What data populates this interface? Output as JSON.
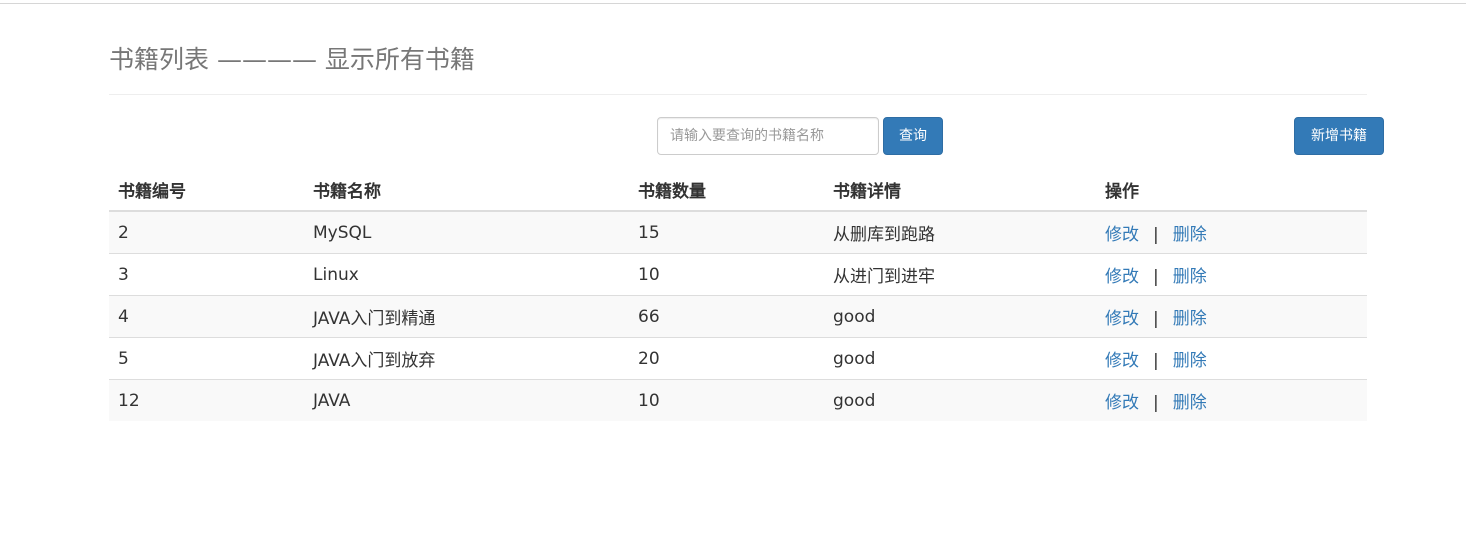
{
  "header": {
    "title": "书籍列表 ———— 显示所有书籍"
  },
  "search": {
    "placeholder": "请输入要查询的书籍名称",
    "value": "",
    "button_label": "查询"
  },
  "toolbar": {
    "add_label": "新增书籍"
  },
  "table": {
    "columns": [
      "书籍编号",
      "书籍名称",
      "书籍数量",
      "书籍详情",
      "操作"
    ],
    "rows": [
      {
        "id": "2",
        "name": "MySQL",
        "count": "15",
        "detail": "从删库到跑路"
      },
      {
        "id": "3",
        "name": "Linux",
        "count": "10",
        "detail": "从进门到进牢"
      },
      {
        "id": "4",
        "name": "JAVA入门到精通",
        "count": "66",
        "detail": "good"
      },
      {
        "id": "5",
        "name": "JAVA入门到放弃",
        "count": "20",
        "detail": "good"
      },
      {
        "id": "12",
        "name": "JAVA",
        "count": "10",
        "detail": "good"
      }
    ],
    "edit_label": "修改",
    "separator": "|",
    "delete_label": "删除"
  },
  "colors": {
    "primary": "#337ab7",
    "link": "#337ab7",
    "header_text": "#777777",
    "stripe": "#f9f9f9"
  }
}
